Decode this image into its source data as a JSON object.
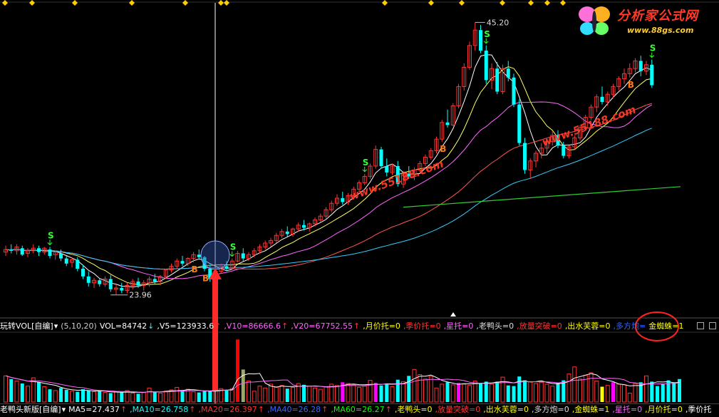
{
  "logo": {
    "title": "分析家公式网",
    "url": "www.88gs.com"
  },
  "watermark_text": "www.55188.com",
  "price_labels": {
    "high": "45.20",
    "low": "23.96"
  },
  "signal_labels": {
    "sell": "S",
    "buy": "B"
  },
  "indicator_bar": {
    "items": [
      {
        "text": "玩转VOL[自编]",
        "color": "#ffffff",
        "arrow": "▾"
      },
      {
        "text": "(5,10,20)",
        "color": "#cccccc"
      },
      {
        "text": "VOL=84742",
        "color": "#ffffff",
        "arrow": "↓",
        "arrow_color": "#00ffff"
      },
      {
        "text": ",V5=123933.6",
        "color": "#ffffff",
        "arrow": "↑",
        "arrow_color": "#ff3333"
      },
      {
        "text": ",V10=86666.6",
        "color": "#ff66ff",
        "arrow": "↑",
        "arrow_color": "#ff3333"
      },
      {
        "text": ",V20=67752.55",
        "color": "#ff66ff",
        "arrow": "↑",
        "arrow_color": "#ff3333"
      },
      {
        "text": ",月价托=0",
        "color": "#ffff00"
      },
      {
        "text": ",季价托=0",
        "color": "#ff3333"
      },
      {
        "text": ",星托=0",
        "color": "#ff66ff"
      },
      {
        "text": ",老鸭头=0",
        "color": "#dddddd"
      },
      {
        "text": ",放量突破=0",
        "color": "#ff3333"
      },
      {
        "text": ",出水芙蓉=0",
        "color": "#ffff00"
      },
      {
        "text": ",多方炮=",
        "color": "#3366ff"
      },
      {
        "text": "金蜘蛛=1",
        "color": "#ffff00"
      }
    ]
  },
  "footer_bar": {
    "items": [
      {
        "text": "老鸭头新版[自编]",
        "color": "#ffffff",
        "arrow": "▾"
      },
      {
        "text": "MA5=27.437",
        "color": "#ffffff",
        "arrow": "↑",
        "arrow_color": "#ff3333"
      },
      {
        "text": ",MA10=26.758",
        "color": "#00ffff",
        "arrow": "↑",
        "arrow_color": "#ff3333"
      },
      {
        "text": ",MA20=26.397",
        "color": "#ff3333",
        "arrow": "↑",
        "arrow_color": "#ff3333"
      },
      {
        "text": ",MA40=26.28",
        "color": "#3366ff",
        "arrow": "↑",
        "arrow_color": "#ff3333"
      },
      {
        "text": ",MA60=26.27",
        "color": "#00ff00",
        "arrow": "↑",
        "arrow_color": "#ff3333"
      },
      {
        "text": ",老鸭头=0",
        "color": "#ffff00"
      },
      {
        "text": ",放量突破=0",
        "color": "#ff3333"
      },
      {
        "text": ",出水芙蓉=0",
        "color": "#ffff00"
      },
      {
        "text": ",多方炮=0",
        "color": "#dddddd"
      },
      {
        "text": ",金蜘蛛=1",
        "color": "#ffff00"
      },
      {
        "text": ",星托=0",
        "color": "#ff66ff"
      },
      {
        "text": ",月价托=0",
        "color": "#ffff00"
      },
      {
        "text": ",季价托",
        "color": "#ffffff"
      }
    ]
  },
  "colors": {
    "bg": "#000000",
    "up": "#ff3333",
    "down": "#00ffff",
    "ma5": "#ffffff",
    "ma10": "#ffff66",
    "ma20": "#ff66ff",
    "ma40": "#ff5555",
    "ma60": "#33ccff",
    "ma120": "#33cc33",
    "vol_spike": "#ff0000",
    "vol_magenta": "#ff00ff",
    "vol_yellow": "#ffff00",
    "vol_olive": "#99aa66",
    "highlight_ring": "#ff2222",
    "arrow": "#ff2a2a"
  },
  "chart_data": {
    "type": "candlestick",
    "price_range": [
      22.5,
      46.5
    ],
    "high_label": 45.2,
    "low_label": 23.96,
    "candles": [
      [
        27.3,
        27.8,
        27.0,
        27.5
      ],
      [
        27.5,
        27.9,
        27.2,
        27.4
      ],
      [
        27.4,
        27.9,
        27.1,
        27.7
      ],
      [
        27.6,
        27.8,
        27.0,
        27.1
      ],
      [
        27.2,
        27.6,
        26.9,
        27.4
      ],
      [
        27.4,
        27.9,
        27.2,
        27.6
      ],
      [
        27.6,
        27.8,
        27.0,
        27.3
      ],
      [
        27.3,
        27.7,
        27.1,
        27.6
      ],
      [
        27.5,
        27.7,
        26.8,
        27.0
      ],
      [
        27.1,
        27.4,
        26.7,
        27.3
      ],
      [
        27.2,
        27.5,
        26.6,
        26.8
      ],
      [
        26.8,
        27.0,
        26.2,
        26.4
      ],
      [
        26.5,
        26.9,
        26.1,
        26.7
      ],
      [
        26.7,
        26.9,
        25.8,
        26.0
      ],
      [
        26.0,
        26.3,
        25.2,
        25.4
      ],
      [
        25.4,
        25.8,
        24.6,
        24.9
      ],
      [
        24.9,
        25.3,
        24.5,
        25.1
      ],
      [
        25.1,
        25.2,
        24.6,
        24.8
      ],
      [
        24.8,
        25.4,
        24.6,
        25.2
      ],
      [
        25.2,
        25.5,
        24.2,
        24.4
      ],
      [
        24.4,
        24.8,
        24.0,
        24.5
      ],
      [
        24.5,
        24.9,
        24.1,
        24.3
      ],
      [
        24.3,
        24.9,
        24.1,
        24.7
      ],
      [
        24.7,
        25.2,
        24.4,
        25.0
      ],
      [
        25.0,
        25.3,
        24.5,
        24.7
      ],
      [
        24.7,
        25.1,
        24.3,
        24.9
      ],
      [
        24.9,
        25.4,
        24.6,
        25.2
      ],
      [
        25.2,
        25.6,
        24.8,
        25.0
      ],
      [
        25.0,
        25.5,
        24.7,
        25.4
      ],
      [
        25.4,
        26.0,
        25.2,
        25.9
      ],
      [
        25.9,
        26.4,
        25.7,
        26.2
      ],
      [
        26.2,
        26.8,
        26.0,
        26.6
      ],
      [
        26.6,
        27.0,
        26.2,
        26.4
      ],
      [
        26.4,
        26.9,
        26.2,
        26.8
      ],
      [
        26.8,
        27.3,
        26.5,
        27.1
      ],
      [
        27.1,
        27.5,
        26.7,
        26.9
      ],
      [
        26.9,
        27.0,
        25.8,
        26.0
      ],
      [
        26.0,
        26.4,
        25.0,
        25.2
      ],
      [
        25.2,
        26.0,
        25.0,
        25.8
      ],
      [
        25.8,
        26.4,
        25.6,
        26.2
      ],
      [
        26.2,
        26.6,
        25.8,
        26.0
      ],
      [
        26.0,
        26.8,
        25.9,
        26.6
      ],
      [
        26.6,
        27.4,
        26.5,
        27.2
      ],
      [
        27.2,
        27.6,
        26.6,
        26.8
      ],
      [
        26.8,
        27.3,
        26.6,
        27.1
      ],
      [
        27.1,
        27.6,
        26.9,
        27.4
      ],
      [
        27.4,
        27.9,
        27.2,
        27.7
      ],
      [
        27.7,
        28.2,
        27.5,
        28.0
      ],
      [
        28.0,
        28.4,
        27.7,
        28.2
      ],
      [
        28.2,
        28.8,
        28.0,
        28.6
      ],
      [
        28.6,
        29.1,
        28.4,
        28.9
      ],
      [
        28.9,
        29.3,
        28.5,
        28.7
      ],
      [
        28.7,
        29.2,
        28.5,
        29.1
      ],
      [
        29.1,
        29.6,
        28.9,
        29.4
      ],
      [
        29.4,
        29.8,
        29.0,
        29.2
      ],
      [
        29.2,
        29.6,
        28.9,
        29.5
      ],
      [
        29.5,
        30.0,
        29.3,
        29.8
      ],
      [
        29.8,
        30.3,
        29.6,
        30.1
      ],
      [
        30.1,
        30.8,
        29.9,
        30.6
      ],
      [
        30.6,
        31.3,
        30.4,
        31.1
      ],
      [
        31.1,
        31.8,
        30.9,
        31.5
      ],
      [
        31.5,
        32.0,
        31.0,
        31.2
      ],
      [
        31.2,
        31.9,
        31.0,
        31.7
      ],
      [
        31.7,
        32.4,
        31.5,
        32.2
      ],
      [
        32.2,
        32.9,
        32.0,
        32.7
      ],
      [
        32.7,
        33.4,
        32.5,
        33.2
      ],
      [
        33.2,
        34.2,
        33.0,
        34.0
      ],
      [
        34.0,
        35.6,
        33.8,
        35.3
      ],
      [
        35.3,
        35.5,
        33.8,
        34.0
      ],
      [
        34.0,
        34.6,
        33.2,
        33.5
      ],
      [
        33.5,
        34.2,
        33.3,
        34.0
      ],
      [
        34.0,
        34.4,
        32.4,
        32.6
      ],
      [
        32.6,
        33.6,
        32.3,
        33.4
      ],
      [
        33.4,
        34.0,
        33.0,
        33.2
      ],
      [
        33.2,
        33.9,
        32.9,
        33.7
      ],
      [
        33.7,
        34.4,
        33.5,
        34.2
      ],
      [
        34.2,
        34.9,
        34.0,
        34.7
      ],
      [
        34.7,
        35.4,
        34.5,
        35.2
      ],
      [
        35.2,
        36.3,
        35.0,
        36.1
      ],
      [
        36.1,
        37.6,
        35.9,
        37.4
      ],
      [
        37.4,
        38.4,
        37.0,
        37.2
      ],
      [
        37.2,
        38.9,
        37.1,
        38.7
      ],
      [
        38.7,
        40.4,
        38.5,
        40.2
      ],
      [
        40.2,
        42.0,
        39.9,
        41.7
      ],
      [
        41.7,
        43.7,
        41.5,
        43.4
      ],
      [
        43.4,
        45.2,
        43.0,
        44.6
      ],
      [
        44.6,
        45.0,
        42.8,
        43.0
      ],
      [
        43.0,
        43.4,
        40.4,
        40.7
      ],
      [
        40.7,
        42.0,
        40.0,
        41.6
      ],
      [
        41.6,
        42.1,
        39.6,
        39.8
      ],
      [
        39.8,
        41.9,
        39.6,
        41.6
      ],
      [
        41.6,
        42.2,
        40.6,
        40.9
      ],
      [
        40.9,
        41.2,
        38.6,
        38.8
      ],
      [
        38.8,
        39.2,
        35.6,
        35.8
      ],
      [
        35.8,
        36.2,
        33.4,
        33.7
      ],
      [
        33.7,
        34.6,
        33.0,
        34.4
      ],
      [
        34.4,
        35.2,
        33.9,
        35.0
      ],
      [
        35.0,
        35.8,
        34.6,
        35.4
      ],
      [
        35.4,
        36.2,
        35.0,
        35.9
      ],
      [
        35.9,
        36.7,
        35.6,
        36.4
      ],
      [
        36.4,
        36.8,
        35.4,
        35.6
      ],
      [
        35.6,
        35.9,
        34.6,
        34.8
      ],
      [
        34.8,
        35.6,
        34.6,
        35.5
      ],
      [
        35.5,
        36.4,
        35.3,
        36.2
      ],
      [
        36.2,
        37.2,
        36.0,
        37.0
      ],
      [
        37.0,
        38.0,
        36.8,
        37.8
      ],
      [
        37.8,
        38.8,
        37.6,
        38.6
      ],
      [
        38.6,
        39.6,
        38.2,
        39.4
      ],
      [
        39.4,
        40.2,
        38.8,
        39.0
      ],
      [
        39.0,
        39.8,
        38.7,
        39.6
      ],
      [
        39.6,
        40.4,
        39.3,
        40.2
      ],
      [
        40.2,
        41.0,
        39.9,
        40.8
      ],
      [
        40.8,
        41.6,
        40.4,
        41.2
      ],
      [
        41.2,
        42.0,
        40.9,
        41.6
      ],
      [
        41.6,
        42.4,
        41.3,
        42.2
      ],
      [
        42.2,
        42.6,
        41.0,
        41.4
      ],
      [
        41.4,
        42.2,
        41.1,
        41.9
      ],
      [
        41.9,
        42.3,
        40.1,
        40.3
      ]
    ],
    "moving_averages": {
      "ma10_end": 41.6,
      "ma20_end": 39.9,
      "ma40_end": 38.6,
      "ma60_end": 37.9,
      "ma120": {
        "start": 30.8,
        "end": 32.4
      }
    },
    "buy_signals": [
      34,
      36,
      79,
      113
    ],
    "sell_signals": [
      8,
      41,
      65,
      87,
      117
    ],
    "volumes": [
      4.1,
      3.6,
      3.3,
      2.9,
      2.5,
      3.8,
      3.1,
      2.4,
      2.0,
      1.8,
      2.2,
      1.9,
      1.7,
      1.6,
      2.0,
      1.8,
      1.6,
      1.7,
      1.5,
      1.4,
      1.6,
      1.5,
      1.8,
      1.4,
      1.3,
      1.5,
      2.2,
      1.6,
      1.4,
      1.7,
      1.9,
      2.3,
      1.8,
      2.0,
      1.6,
      1.5,
      1.8,
      1.7,
      1.9,
      2.1,
      1.9,
      2.1,
      9.8,
      5.1,
      3.3,
      1.7,
      2.5,
      2.2,
      2.8,
      2.4,
      2.6,
      2.1,
      2.3,
      2.9,
      2.7,
      2.5,
      2.2,
      2.0,
      2.4,
      2.8,
      2.6,
      3.1,
      2.9,
      2.7,
      2.3,
      2.5,
      3.4,
      3.0,
      2.6,
      2.8,
      2.4,
      3.5,
      3.2,
      4.1,
      5.1,
      4.3,
      3.6,
      4.0,
      2.2,
      2.8,
      3.1,
      2.7,
      3.0,
      2.8,
      2.6,
      3.3,
      3.0,
      3.2,
      2.8,
      3.2,
      3.9,
      2.6,
      2.5,
      4.0,
      3.4,
      3.2,
      2.9,
      3.1,
      2.8,
      2.5,
      3.0,
      3.4,
      4.4,
      5.5,
      3.6,
      4.2,
      4.6,
      3.3,
      2.4,
      2.6,
      3.1,
      2.8,
      2.7,
      1.4,
      2.9,
      3.1,
      4.1,
      3.2,
      2.5,
      2.8,
      3.4,
      3.1,
      3.6
    ],
    "volume_max": 10.5,
    "volume_ma5_end": 3.3,
    "volume_ma10_end": 3.0
  }
}
